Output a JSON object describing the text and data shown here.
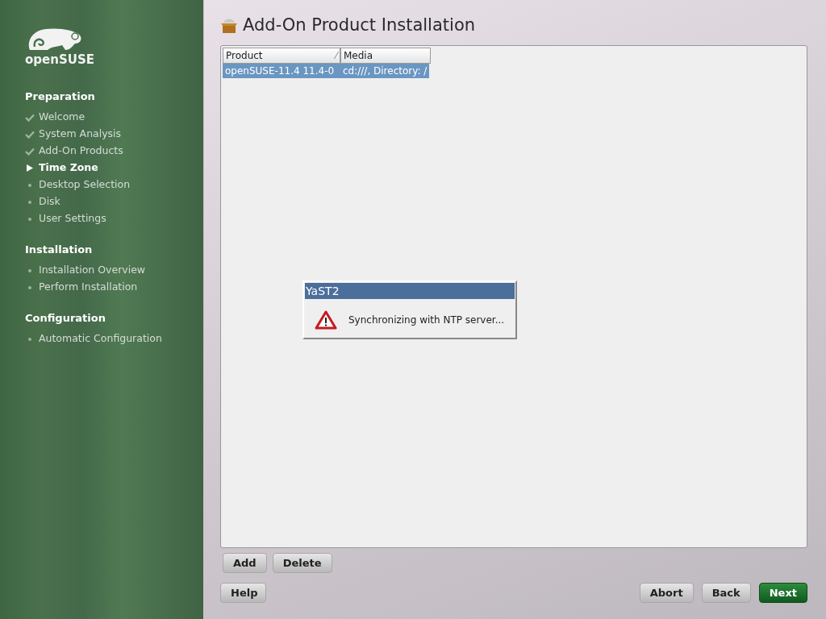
{
  "sidebar": {
    "logo_text": "openSUSE",
    "sections": [
      {
        "title": "Preparation",
        "steps": [
          {
            "label": "Welcome",
            "done": true,
            "current": false
          },
          {
            "label": "System Analysis",
            "done": true,
            "current": false
          },
          {
            "label": "Add-On Products",
            "done": true,
            "current": false
          },
          {
            "label": "Time Zone",
            "done": false,
            "current": true
          },
          {
            "label": "Desktop Selection",
            "done": false,
            "current": false
          },
          {
            "label": "Disk",
            "done": false,
            "current": false
          },
          {
            "label": "User Settings",
            "done": false,
            "current": false
          }
        ]
      },
      {
        "title": "Installation",
        "steps": [
          {
            "label": "Installation Overview",
            "done": false,
            "current": false
          },
          {
            "label": "Perform Installation",
            "done": false,
            "current": false
          }
        ]
      },
      {
        "title": "Configuration",
        "steps": [
          {
            "label": "Automatic Configuration",
            "done": false,
            "current": false
          }
        ]
      }
    ]
  },
  "page": {
    "title": "Add-On Product Installation"
  },
  "table": {
    "columns": [
      {
        "label": "Product",
        "sort_mark": "⁄"
      },
      {
        "label": "Media"
      }
    ],
    "rows": [
      {
        "cells": [
          "openSUSE-11.4 11.4-0",
          "cd:///, Directory: /"
        ],
        "selected": true
      }
    ]
  },
  "list_buttons": [
    "Add",
    "Delete"
  ],
  "dialog": {
    "title": "YaST2",
    "message": "Synchronizing with NTP server..."
  },
  "footer": {
    "left": [
      {
        "label": "Help",
        "primary": false
      }
    ],
    "right": [
      {
        "label": "Abort",
        "primary": false
      },
      {
        "label": "Back",
        "primary": false
      },
      {
        "label": "Next",
        "primary": true
      }
    ]
  }
}
